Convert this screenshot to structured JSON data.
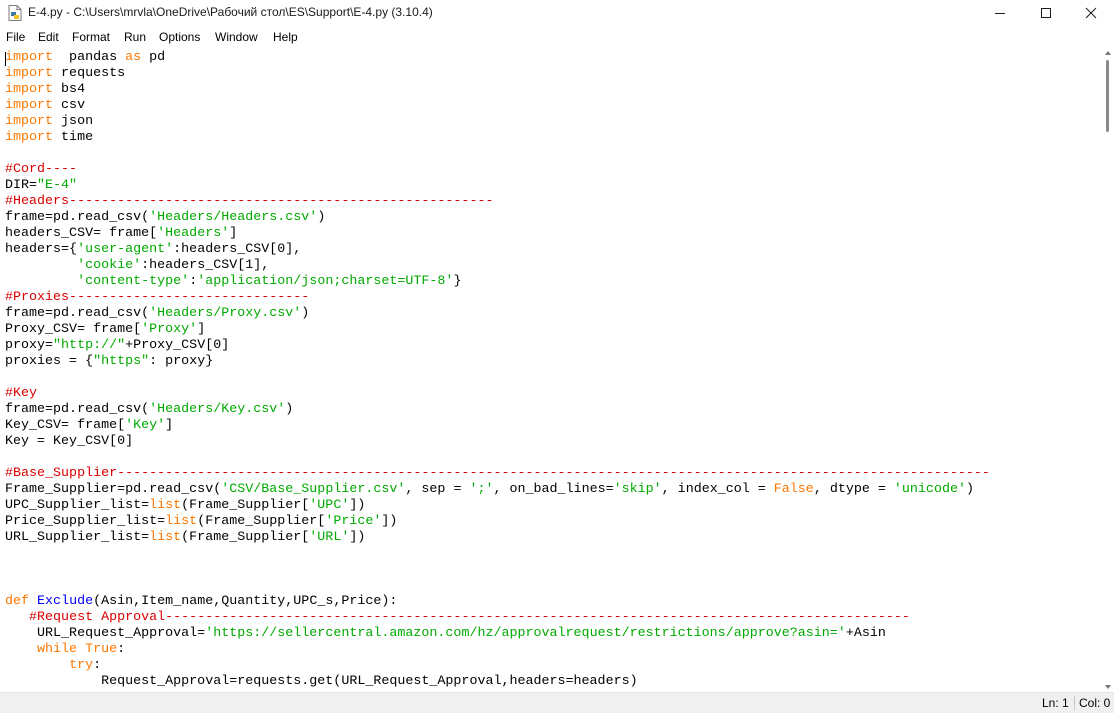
{
  "window": {
    "title": "E-4.py - C:\\Users\\mrvla\\OneDrive\\Рабочий стол\\ES\\Support\\E-4.py (3.10.4)",
    "controls": [
      "minimize",
      "maximize",
      "close"
    ]
  },
  "menu": {
    "file": "File",
    "edit": "Edit",
    "format": "Format",
    "run": "Run",
    "options": "Options",
    "window": "Window",
    "help": "Help"
  },
  "colors": {
    "keyword": "#ff7700",
    "string": "#00aa00",
    "comment": "#dd0000",
    "definition": "#0000ff"
  },
  "editor": {
    "lines": [
      [
        [
          "kw",
          "import"
        ],
        [
          "",
          "  pandas "
        ],
        [
          "kw",
          "as"
        ],
        [
          "",
          " pd"
        ]
      ],
      [
        [
          "kw",
          "import"
        ],
        [
          "",
          " requests"
        ]
      ],
      [
        [
          "kw",
          "import"
        ],
        [
          "",
          " bs4"
        ]
      ],
      [
        [
          "kw",
          "import"
        ],
        [
          "",
          " csv"
        ]
      ],
      [
        [
          "kw",
          "import"
        ],
        [
          "",
          " json"
        ]
      ],
      [
        [
          "kw",
          "import"
        ],
        [
          "",
          " time"
        ]
      ],
      [],
      [
        [
          "cm",
          "#Cord----"
        ]
      ],
      [
        [
          "",
          "DIR="
        ],
        [
          "st",
          "\"E-4\""
        ]
      ],
      [
        [
          "cm",
          "#Headers-----------------------------------------------------"
        ]
      ],
      [
        [
          "",
          "frame=pd.read_csv("
        ],
        [
          "st",
          "'Headers/Headers.csv'"
        ],
        [
          "",
          ")"
        ]
      ],
      [
        [
          "",
          "headers_CSV= frame["
        ],
        [
          "st",
          "'Headers'"
        ],
        [
          "",
          "]"
        ]
      ],
      [
        [
          "",
          "headers={"
        ],
        [
          "st",
          "'user-agent'"
        ],
        [
          "",
          ":headers_CSV[0],"
        ]
      ],
      [
        [
          "",
          "         "
        ],
        [
          "st",
          "'cookie'"
        ],
        [
          "",
          ":headers_CSV[1],"
        ]
      ],
      [
        [
          "",
          "         "
        ],
        [
          "st",
          "'content-type'"
        ],
        [
          "",
          ":"
        ],
        [
          "st",
          "'application/json;charset=UTF-8'"
        ],
        [
          "",
          "}"
        ]
      ],
      [
        [
          "cm",
          "#Proxies------------------------------"
        ]
      ],
      [
        [
          "",
          "frame=pd.read_csv("
        ],
        [
          "st",
          "'Headers/Proxy.csv'"
        ],
        [
          "",
          ")"
        ]
      ],
      [
        [
          "",
          "Proxy_CSV= frame["
        ],
        [
          "st",
          "'Proxy'"
        ],
        [
          "",
          "]"
        ]
      ],
      [
        [
          "",
          "proxy="
        ],
        [
          "st",
          "\"http://\""
        ],
        [
          "",
          "+Proxy_CSV[0]"
        ]
      ],
      [
        [
          "",
          "proxies = {"
        ],
        [
          "st",
          "\"https\""
        ],
        [
          "",
          ": proxy}"
        ]
      ],
      [],
      [
        [
          "cm",
          "#Key"
        ]
      ],
      [
        [
          "",
          "frame=pd.read_csv("
        ],
        [
          "st",
          "'Headers/Key.csv'"
        ],
        [
          "",
          ")"
        ]
      ],
      [
        [
          "",
          "Key_CSV= frame["
        ],
        [
          "st",
          "'Key'"
        ],
        [
          "",
          "]"
        ]
      ],
      [
        [
          "",
          "Key = Key_CSV[0]"
        ]
      ],
      [],
      [
        [
          "cm",
          "#Base_Supplier-------------------------------------------------------------------------------------------------------------"
        ]
      ],
      [
        [
          "",
          "Frame_Supplier=pd.read_csv("
        ],
        [
          "st",
          "'CSV/Base_Supplier.csv'"
        ],
        [
          "",
          ", sep = "
        ],
        [
          "st",
          "';'"
        ],
        [
          "",
          ", on_bad_lines="
        ],
        [
          "st",
          "'skip'"
        ],
        [
          "",
          ", index_col = "
        ],
        [
          "kw",
          "False"
        ],
        [
          "",
          ", dtype = "
        ],
        [
          "st",
          "'unicode'"
        ],
        [
          "",
          ")"
        ]
      ],
      [
        [
          "",
          "UPC_Supplier_list="
        ],
        [
          "kw",
          "list"
        ],
        [
          "",
          "(Frame_Supplier["
        ],
        [
          "st",
          "'UPC'"
        ],
        [
          "",
          "])"
        ]
      ],
      [
        [
          "",
          "Price_Supplier_list="
        ],
        [
          "kw",
          "list"
        ],
        [
          "",
          "(Frame_Supplier["
        ],
        [
          "st",
          "'Price'"
        ],
        [
          "",
          "])"
        ]
      ],
      [
        [
          "",
          "URL_Supplier_list="
        ],
        [
          "kw",
          "list"
        ],
        [
          "",
          "(Frame_Supplier["
        ],
        [
          "st",
          "'URL'"
        ],
        [
          "",
          "])"
        ]
      ],
      [],
      [],
      [],
      [
        [
          "kw",
          "def"
        ],
        [
          "",
          " "
        ],
        [
          "df",
          "Exclude"
        ],
        [
          "",
          "(Asin,Item_name,Quantity,UPC_s,Price):"
        ]
      ],
      [
        [
          "",
          "   "
        ],
        [
          "cm",
          "#Request Approval---------------------------------------------------------------------------------------------"
        ]
      ],
      [
        [
          "",
          "    URL_Request_Approval="
        ],
        [
          "st",
          "'https://sellercentral.amazon.com/hz/approvalrequest/restrictions/approve?asin='"
        ],
        [
          "",
          "+Asin"
        ]
      ],
      [
        [
          "",
          "    "
        ],
        [
          "kw",
          "while"
        ],
        [
          "",
          " "
        ],
        [
          "kw",
          "True"
        ],
        [
          "",
          ":"
        ]
      ],
      [
        [
          "",
          "        "
        ],
        [
          "kw",
          "try"
        ],
        [
          "",
          ":"
        ]
      ],
      [
        [
          "",
          "            Request_Approval=requests.get(URL_Request_Approval,headers=headers)"
        ]
      ]
    ]
  },
  "status": {
    "ln": "Ln: 1",
    "col": "Col: 0"
  }
}
